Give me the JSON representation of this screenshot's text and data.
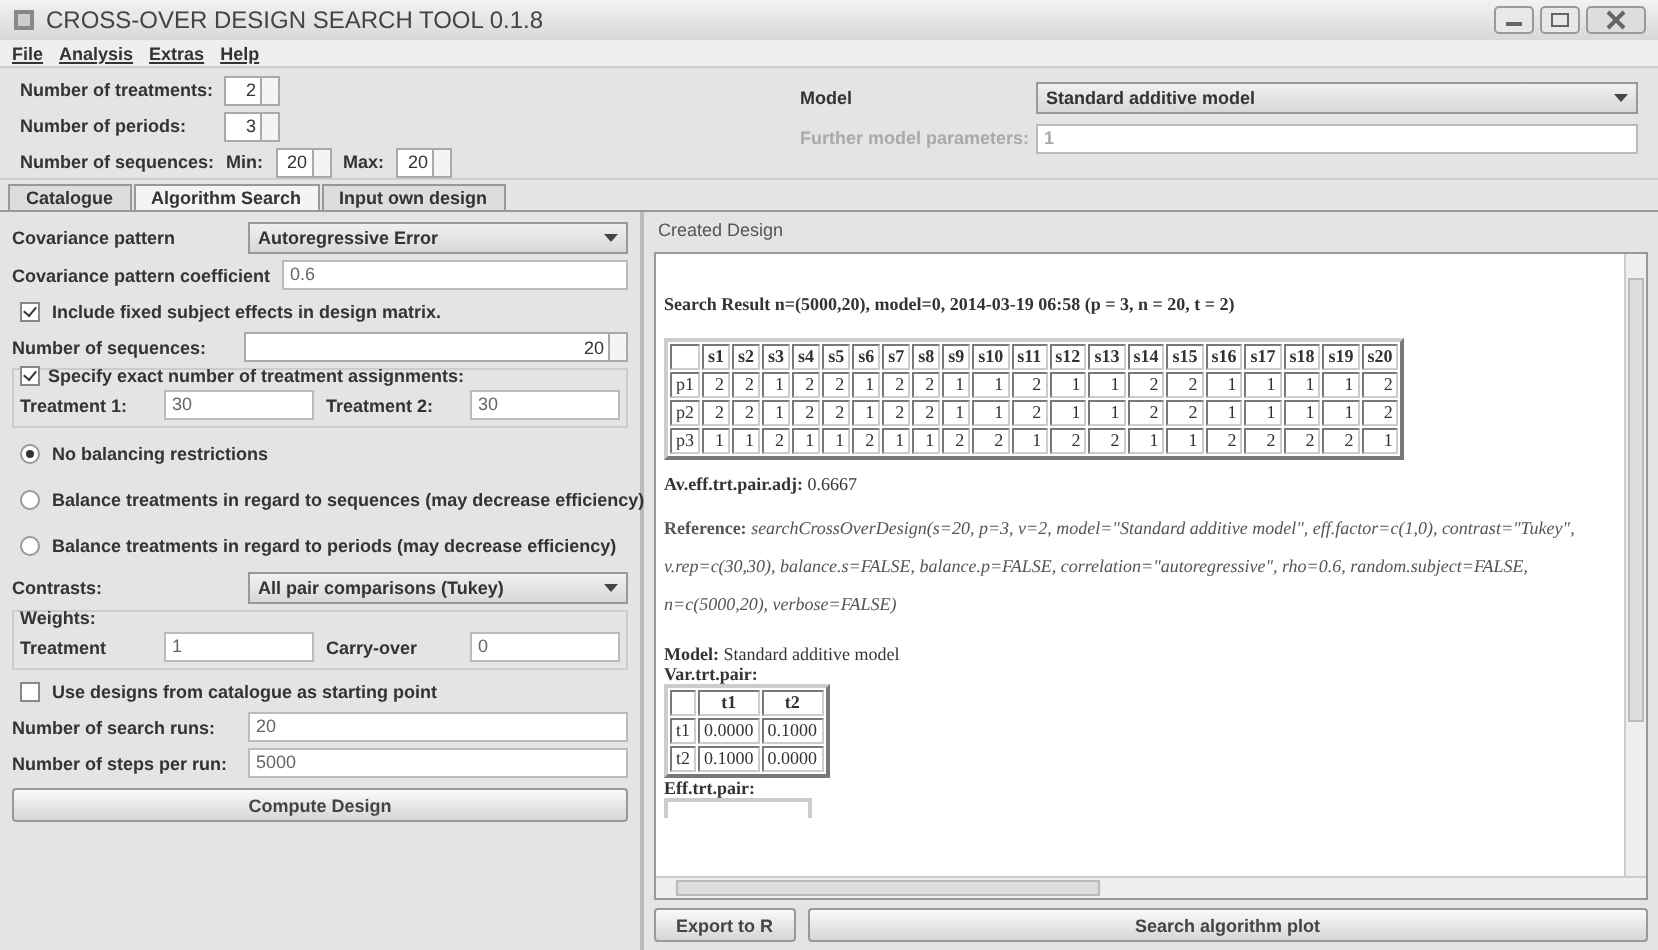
{
  "window": {
    "title": "CROSS-OVER DESIGN SEARCH TOOL 0.1.8"
  },
  "menu": [
    "File",
    "Analysis",
    "Extras",
    "Help"
  ],
  "params": {
    "treatments_label": "Number of treatments:",
    "treatments": "2",
    "periods_label": "Number of periods:",
    "periods": "3",
    "sequences_label": "Number of sequences:",
    "min_label": "Min:",
    "min": "20",
    "max_label": "Max:",
    "max": "20"
  },
  "model": {
    "label": "Model",
    "value": "Standard additive model",
    "further_label": "Further model parameters:",
    "further_value": "1"
  },
  "tabs": [
    {
      "label": "Catalogue",
      "selected": false
    },
    {
      "label": "Algorithm Search",
      "selected": true
    },
    {
      "label": "Input own design",
      "selected": false
    }
  ],
  "form": {
    "cov_label": "Covariance pattern",
    "cov_value": "Autoregressive Error",
    "coef_label": "Covariance pattern coefficient",
    "coef_value": "0.6",
    "fixed": {
      "label": "Include fixed subject effects in design matrix.",
      "checked": true
    },
    "seq_label": "Number of sequences:",
    "seq_value": "20",
    "exact": {
      "label": "Specify exact number of treatment assignments:",
      "checked": true
    },
    "t1_label": "Treatment 1:",
    "t1_value": "30",
    "t2_label": "Treatment 2:",
    "t2_value": "30",
    "balancing": [
      {
        "label": "No balancing restrictions",
        "selected": true
      },
      {
        "label": "Balance treatments in regard to sequences (may decrease efficiency)",
        "selected": false
      },
      {
        "label": "Balance treatments in regard to periods (may decrease efficiency)",
        "selected": false
      }
    ],
    "contrasts_label": "Contrasts:",
    "contrasts_value": "All pair comparisons (Tukey)",
    "weights_label": "Weights:",
    "w_treat_label": "Treatment",
    "w_treat_value": "1",
    "w_carry_label": "Carry-over",
    "w_carry_value": "0",
    "catalogue": {
      "label": "Use designs from catalogue as starting point",
      "checked": false
    },
    "runs_label": "Number of search runs:",
    "runs_value": "20",
    "steps_label": "Number of steps per run:",
    "steps_value": "5000",
    "compute": "Compute Design"
  },
  "result": {
    "panel_title": "Created Design",
    "heading": "Search Result n=(5000,20), model=0, 2014-03-19 06:58 (p = 3, n = 20, t = 2)",
    "design": {
      "columns": [
        "s1",
        "s2",
        "s3",
        "s4",
        "s5",
        "s6",
        "s7",
        "s8",
        "s9",
        "s10",
        "s11",
        "s12",
        "s13",
        "s14",
        "s15",
        "s16",
        "s17",
        "s18",
        "s19",
        "s20"
      ],
      "rows": [
        {
          "label": "p1",
          "cells": [
            "2",
            "2",
            "1",
            "2",
            "2",
            "1",
            "2",
            "2",
            "1",
            "1",
            "2",
            "1",
            "1",
            "2",
            "2",
            "1",
            "1",
            "1",
            "1",
            "2"
          ]
        },
        {
          "label": "p2",
          "cells": [
            "2",
            "2",
            "1",
            "2",
            "2",
            "1",
            "2",
            "2",
            "1",
            "1",
            "2",
            "1",
            "1",
            "2",
            "2",
            "1",
            "1",
            "1",
            "1",
            "2"
          ]
        },
        {
          "label": "p3",
          "cells": [
            "1",
            "1",
            "2",
            "1",
            "1",
            "2",
            "1",
            "1",
            "2",
            "2",
            "1",
            "2",
            "2",
            "1",
            "1",
            "2",
            "2",
            "2",
            "2",
            "1"
          ]
        }
      ]
    },
    "av_eff": "**Av.eff.trt.pair.adj:** 0.6667",
    "reference": "**Reference:** *searchCrossOverDesign(s=20, p=3, v=2, model=\"Standard additive model\", eff.factor=c(1,0), contrast=\"Tukey\", v.rep=c(30,30), balance.s=FALSE, balance.p=FALSE, correlation=\"autoregressive\", rho=0.6, random.subject=FALSE, n=c(5000,20), verbose=FALSE)*",
    "model_line": "**Model:** Standard additive model",
    "var_title": "Var.trt.pair:",
    "var": {
      "columns": [
        "t1",
        "t2"
      ],
      "rows": [
        {
          "label": "t1",
          "cells": [
            "0.0000",
            "0.1000"
          ]
        },
        {
          "label": "t2",
          "cells": [
            "0.1000",
            "0.0000"
          ]
        }
      ]
    },
    "eff_title": "Eff.trt.pair:"
  },
  "buttons": [
    "Export to R",
    "Search algorithm plot"
  ]
}
